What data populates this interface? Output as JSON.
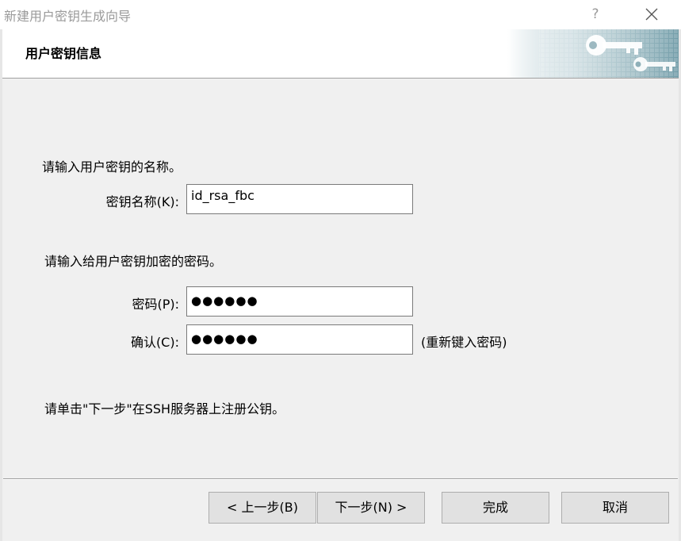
{
  "window": {
    "title": "新建用户密钥生成向导",
    "help_label": "?"
  },
  "header": {
    "title": "用户密钥信息",
    "banner_icon": "key-icon"
  },
  "form": {
    "key_name_prompt": "请输入用户密钥的名称。",
    "key_name_label": "密钥名称(K):",
    "key_name_value": "id_rsa_fbc",
    "password_prompt": "请输入给用户密钥加密的密码。",
    "password_label": "密码(P):",
    "password_value": "●●●●●●",
    "confirm_label": "确认(C):",
    "confirm_value": "●●●●●●",
    "confirm_hint": "(重新键入密码)",
    "register_note": "请单击\"下一步\"在SSH服务器上注册公钥。"
  },
  "buttons": {
    "back": "< 上一步(B)",
    "next": "下一步(N) >",
    "finish": "完成",
    "cancel": "取消"
  },
  "colors": {
    "window_bg": "#f0f0f0",
    "header_bg": "#ffffff",
    "button_bg": "#e1e1e1",
    "banner_teal": "#6e9aa6"
  }
}
